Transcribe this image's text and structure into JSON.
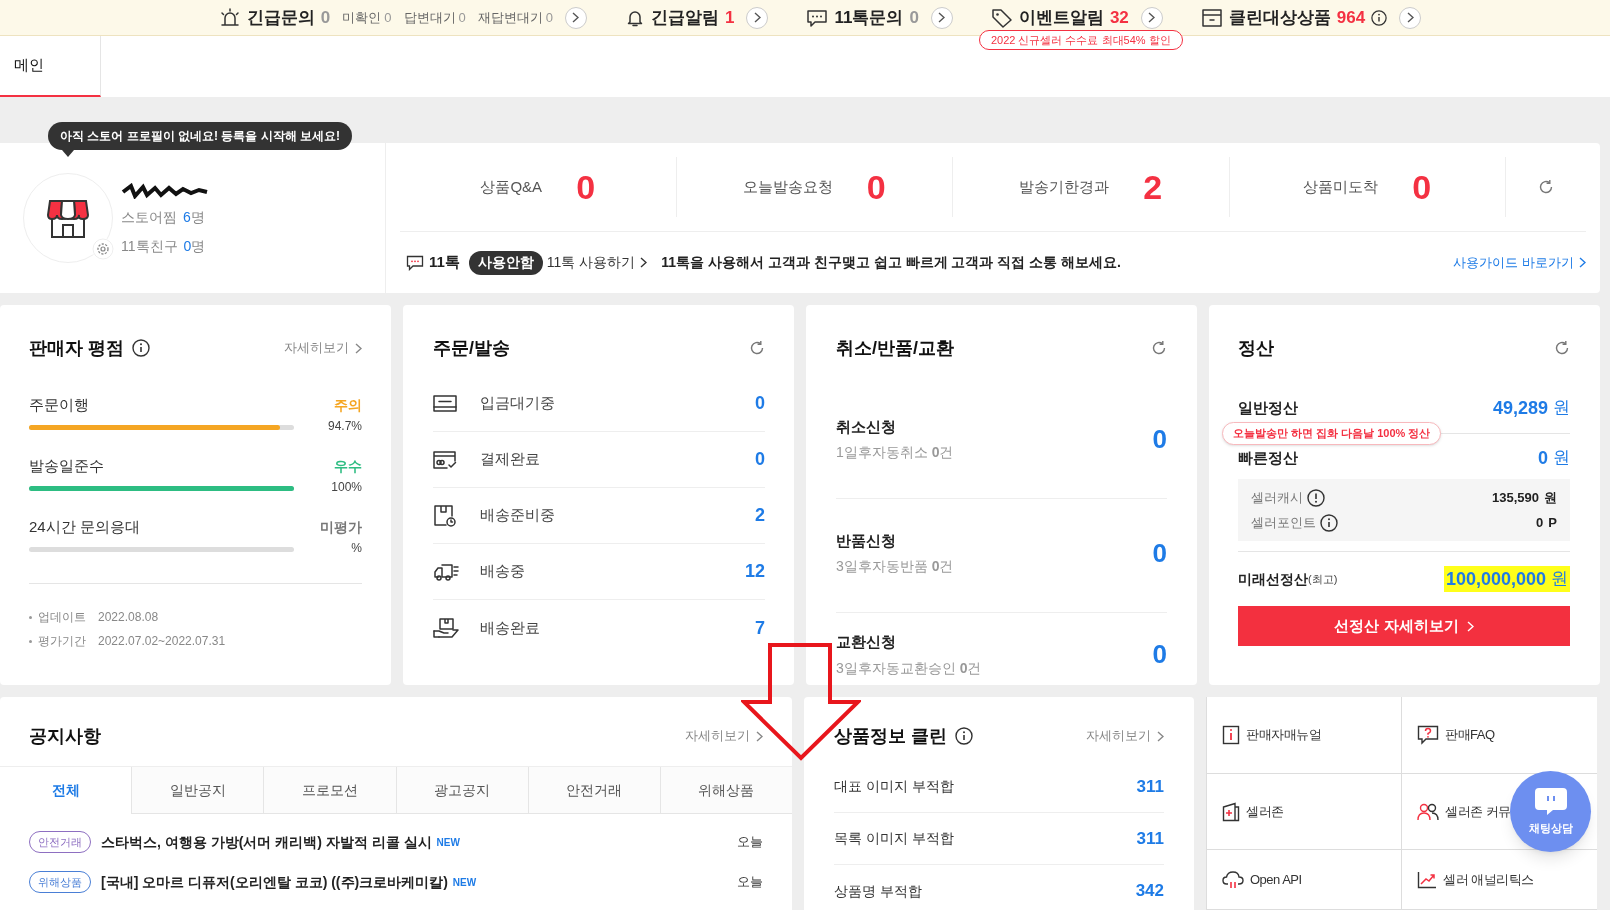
{
  "alert_bar": {
    "items": [
      {
        "kind": "siren",
        "label": "긴급문의",
        "count": "0",
        "highlight": false,
        "sub": [
          {
            "label": "미확인",
            "count": "0"
          },
          {
            "label": "답변대기",
            "count": "0"
          },
          {
            "label": "재답변대기",
            "count": "0"
          }
        ]
      },
      {
        "kind": "bell",
        "label": "긴급알림",
        "count": "1",
        "highlight": true
      },
      {
        "kind": "chat",
        "label": "11톡문의",
        "count": "0",
        "highlight": false
      },
      {
        "kind": "tag",
        "label": "이벤트알림",
        "count": "32",
        "highlight": true,
        "badge": "2022 신규셀러 수수료 최대54% 할인"
      },
      {
        "kind": "clean",
        "label": "클린대상상품",
        "count": "964",
        "highlight": true,
        "info": true
      }
    ]
  },
  "tabs": [
    {
      "label": "메인",
      "selected": true
    }
  ],
  "profile": {
    "tooltip": "아직 스토어 프로필이 없네요! 등록을 시작해 보세요!",
    "stats": [
      {
        "label": "스토어찜",
        "value": "6",
        "unit": "명"
      },
      {
        "label": "11톡친구",
        "value": "0",
        "unit": "명"
      }
    ]
  },
  "summary": [
    {
      "label": "상품Q&A",
      "count": "0"
    },
    {
      "label": "오늘발송요청",
      "count": "0"
    },
    {
      "label": "발송기한경과",
      "count": "2"
    },
    {
      "label": "상품미도착",
      "count": "0"
    }
  ],
  "talk": {
    "label": "11톡",
    "status": "사용안함",
    "link": "11톡 사용하기",
    "message": "11톡을 사용해서 고객과 친구맺고 쉽고 빠르게 고객과 직접 소통 해보세요.",
    "guide_link": "사용가이드 바로가기"
  },
  "seller_rating": {
    "title": "판매자 평점",
    "more": "자세히보기",
    "metrics": [
      {
        "label": "주문이행",
        "grade": "주의",
        "color": "#f5a623",
        "percent": "94.7%",
        "level": 0.947
      },
      {
        "label": "발송일준수",
        "grade": "우수",
        "color": "#2dbd82",
        "percent": "100%",
        "level": 1
      },
      {
        "label": "24시간 문의응대",
        "grade": "미평가",
        "color": "#777777",
        "percent": "%",
        "level": 0
      }
    ],
    "footer": [
      {
        "label": "업데이트",
        "value": "2022.08.08"
      },
      {
        "label": "평가기간",
        "value": "2022.07.02~2022.07.31"
      }
    ]
  },
  "orders": {
    "title": "주문/발송",
    "rows": [
      {
        "kind": "bank",
        "label": "입금대기중",
        "count": "0"
      },
      {
        "kind": "payment",
        "label": "결제완료",
        "count": "0"
      },
      {
        "kind": "prepare",
        "label": "배송준비중",
        "count": "2"
      },
      {
        "kind": "truck",
        "label": "배송중",
        "count": "12"
      },
      {
        "kind": "delivered",
        "label": "배송완료",
        "count": "7"
      }
    ]
  },
  "claims": {
    "title": "취소/반품/교환",
    "rows": [
      {
        "label": "취소신청",
        "sub": "1일후자동취소 **0**건",
        "count": "0"
      },
      {
        "label": "반품신청",
        "sub": "3일후자동반품 **0**건",
        "count": "0"
      },
      {
        "label": "교환신청",
        "sub": "3일후자동교환승인 **0**건",
        "count": "0"
      }
    ]
  },
  "settlement": {
    "title": "정산",
    "general": {
      "label": "일반정산",
      "amount": "49,289",
      "unit": "원"
    },
    "tooltip": "오늘발송만 하면 집화 다음날 100% 정산",
    "fast": {
      "label": "빠른정산",
      "amount": "0",
      "unit": "원"
    },
    "details": [
      {
        "label": "셀러캐시",
        "kind": "alert",
        "value": "135,590",
        "unit": "원"
      },
      {
        "label": "셀러포인트",
        "kind": "info",
        "value": "0",
        "unit": "P"
      }
    ],
    "future": {
      "label": "미래선정산",
      "note": "(최고)",
      "amount": "100,000,000",
      "unit": "원",
      "highlighted": true
    },
    "button": "선정산 자세히보기"
  },
  "notices": {
    "title": "공지사항",
    "more": "자세히보기",
    "tabs": [
      {
        "label": "전체",
        "selected": true
      },
      {
        "label": "일반공지",
        "selected": false
      },
      {
        "label": "프로모션",
        "selected": false
      },
      {
        "label": "광고공지",
        "selected": false
      },
      {
        "label": "안전거래",
        "selected": false
      },
      {
        "label": "위해상품",
        "selected": false
      }
    ],
    "items": [
      {
        "tag": "안전거래",
        "color": "#8e6fc1",
        "title": "스타벅스, 여행용 가방(서머 캐리백) 자발적 리콜 실시",
        "new": "NEW",
        "date": "오늘"
      },
      {
        "tag": "위해상품",
        "color": "#4a7fd6",
        "title": "[국내] 오마르 디퓨저(오리엔탈 코코) ((주)크로바케미칼)",
        "new": "NEW",
        "date": "오늘"
      }
    ]
  },
  "clean": {
    "title": "상품정보 클린",
    "more": "자세히보기",
    "rows": [
      {
        "label": "대표 이미지 부적합",
        "count": "311"
      },
      {
        "label": "목록 이미지 부적합",
        "count": "311"
      },
      {
        "label": "상품명 부적합",
        "count": "342"
      }
    ]
  },
  "links": [
    {
      "kind": "manual",
      "label": "판매자매뉴얼"
    },
    {
      "kind": "faq",
      "label": "판매FAQ"
    },
    {
      "kind": "zone",
      "label": "셀러존"
    },
    {
      "kind": "community",
      "label": "셀러존 커뮤"
    },
    {
      "kind": "api",
      "label": "Open API"
    },
    {
      "kind": "analytics",
      "label": "셀러 애널리틱스"
    }
  ],
  "chat_button": {
    "label": "채팅상담"
  }
}
